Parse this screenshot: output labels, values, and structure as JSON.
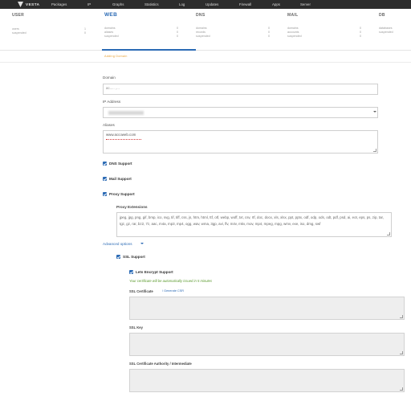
{
  "topnav": {
    "logo": "VESTA",
    "items": [
      "Packages",
      "IP",
      "Graphs",
      "Statistics",
      "Log",
      "Updates",
      "Firewall",
      "Apps",
      "Server"
    ]
  },
  "stats": {
    "user": {
      "title": "USER",
      "rows": [
        {
          "label": "users",
          "value": "1"
        },
        {
          "label": "suspended",
          "value": "0"
        }
      ]
    },
    "web": {
      "title": "WEB",
      "rows": [
        {
          "label": "domains",
          "value": "0"
        },
        {
          "label": "aliases",
          "value": "0"
        },
        {
          "label": "suspended",
          "value": "0"
        }
      ]
    },
    "dns": {
      "title": "DNS",
      "rows": [
        {
          "label": "domains",
          "value": "0"
        },
        {
          "label": "records",
          "value": "0"
        },
        {
          "label": "suspended",
          "value": "0"
        }
      ]
    },
    "mail": {
      "title": "MAIL",
      "rows": [
        {
          "label": "domains",
          "value": "0"
        },
        {
          "label": "accounts",
          "value": "0"
        },
        {
          "label": "suspended",
          "value": "0"
        }
      ]
    },
    "db": {
      "title": "DB",
      "rows": [
        {
          "label": "databases",
          "value": ""
        },
        {
          "label": "suspended",
          "value": ""
        }
      ]
    }
  },
  "section_tab": "Adding Domain",
  "form": {
    "domain_label": "Domain",
    "domain_value": "ac..... ,...",
    "ip_label": "IP Address",
    "aliases_label": "Aliases",
    "aliases_value": "www.accoweb.com",
    "dns_support": "DNS Support",
    "mail_support": "Mail Support",
    "proxy_support": "Proxy Support",
    "proxy_ext_label": "Proxy Extensions",
    "proxy_ext_value": "jpeg, jpg, png, gif, bmp, ico, svg, tif, tiff, css, js, htm, html, ttf, otf, webp, woff, txt, csv, rtf, doc, docx, xls, xlsx, ppt, pptx, odf, odp, ods, odt, pdf, psd, ai, eot, eps, ps, zip, tar, tgz, gz, rar, bz2, 7z, aac, m4a, mp3, mp4, ogg, wav, wma, 3gp, avi, flv, m4v, mkv, mov, mp4, mpeg, mpg, wmv, exe, iso, dmg, swf",
    "advanced": "Advanced options",
    "ssl_support": "SSL Support",
    "letsencrypt": "Lets Encrypt Support",
    "letsencrypt_note": "Your certificate will be automatically issued in 5 minutes",
    "ssl_cert_label": "SSL Certificate",
    "generate_csr": "/ Generate CSR",
    "ssl_key_label": "SSL Key",
    "ssl_ca_label": "SSL Certificate Authority / Intermediate"
  }
}
